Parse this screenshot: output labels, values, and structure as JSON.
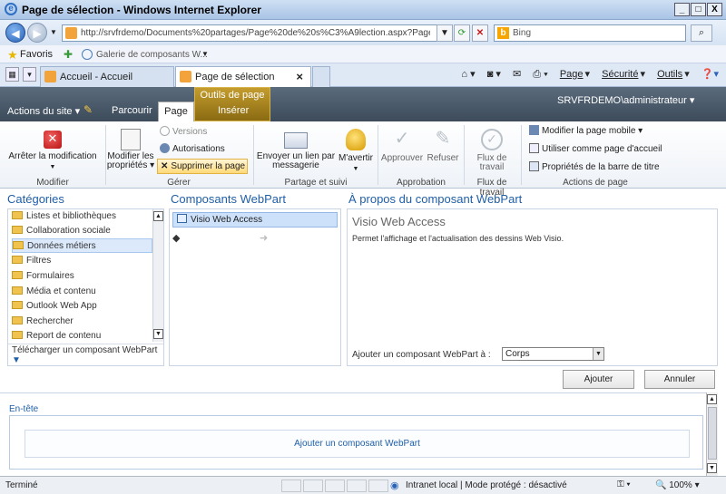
{
  "window": {
    "title": "Page de sélection - Windows Internet Explorer",
    "controls": [
      "_",
      "□",
      "X"
    ]
  },
  "address": {
    "url": "http://srvfrdemo/Documents%20partages/Page%20de%20s%C3%A9lection.aspx?PageView=Sl",
    "search_placeholder": "Bing"
  },
  "favorites": {
    "label": "Favoris",
    "gallery": "Galerie de composants W..."
  },
  "tabs": [
    {
      "label": "Accueil - Accueil"
    },
    {
      "label": "Page de sélection"
    }
  ],
  "commandbar": {
    "page": "Page",
    "security": "Sécurité",
    "tools": "Outils"
  },
  "sharepoint": {
    "site_actions": "Actions du site",
    "tab_browse": "Parcourir",
    "tab_page": "Page",
    "tab_insert": "Insérer",
    "contextual_group": "Outils de page",
    "user": "SRVFRDEMO\\administrateur"
  },
  "ribbon": {
    "stop_edit": "Arrêter la modification",
    "modify_props_1": "Modifier les",
    "modify_props_2": "propriétés",
    "versions": "Versions",
    "permissions": "Autorisations",
    "delete_page": "Supprimer la page",
    "email_link_1": "Envoyer un lien par",
    "email_link_2": "messagerie",
    "alert_me": "M'avertir",
    "approve": "Approuver",
    "reject": "Refuser",
    "workflow_1": "Flux de",
    "workflow_2": "travail",
    "mobile_page": "Modifier la page mobile",
    "set_home": "Utiliser comme page d'accueil",
    "title_bar_props": "Propriétés de la barre de titre",
    "groups": {
      "edit": "Modifier",
      "manage": "Gérer",
      "share": "Partage et suivi",
      "approval": "Approbation",
      "workflow": "Flux de travail",
      "page_actions": "Actions de page"
    }
  },
  "categories": {
    "title": "Catégories",
    "items": [
      "Listes et bibliothèques",
      "Collaboration sociale",
      "Données métiers",
      "Filtres",
      "Formulaires",
      "Média et contenu",
      "Outlook Web App",
      "Rechercher",
      "Report de contenu"
    ],
    "selected": "Données métiers",
    "upload": "Télécharger un composant WebPart"
  },
  "webparts": {
    "title": "Composants WebPart",
    "items": [
      "Visio Web Access"
    ]
  },
  "about": {
    "title": "À propos du composant WebPart",
    "wp_name": "Visio Web Access",
    "description": "Permet l'affichage et l'actualisation des dessins Web Visio.",
    "add_to_label": "Ajouter un composant WebPart à :",
    "zone_value": "Corps",
    "add_button": "Ajouter",
    "cancel_button": "Annuler"
  },
  "page_zone": {
    "header": "En-tête",
    "add_webpart": "Ajouter un composant WebPart"
  },
  "status": {
    "text": "Terminé",
    "zone": "Intranet local | Mode protégé : désactivé",
    "zoom": "100%"
  }
}
